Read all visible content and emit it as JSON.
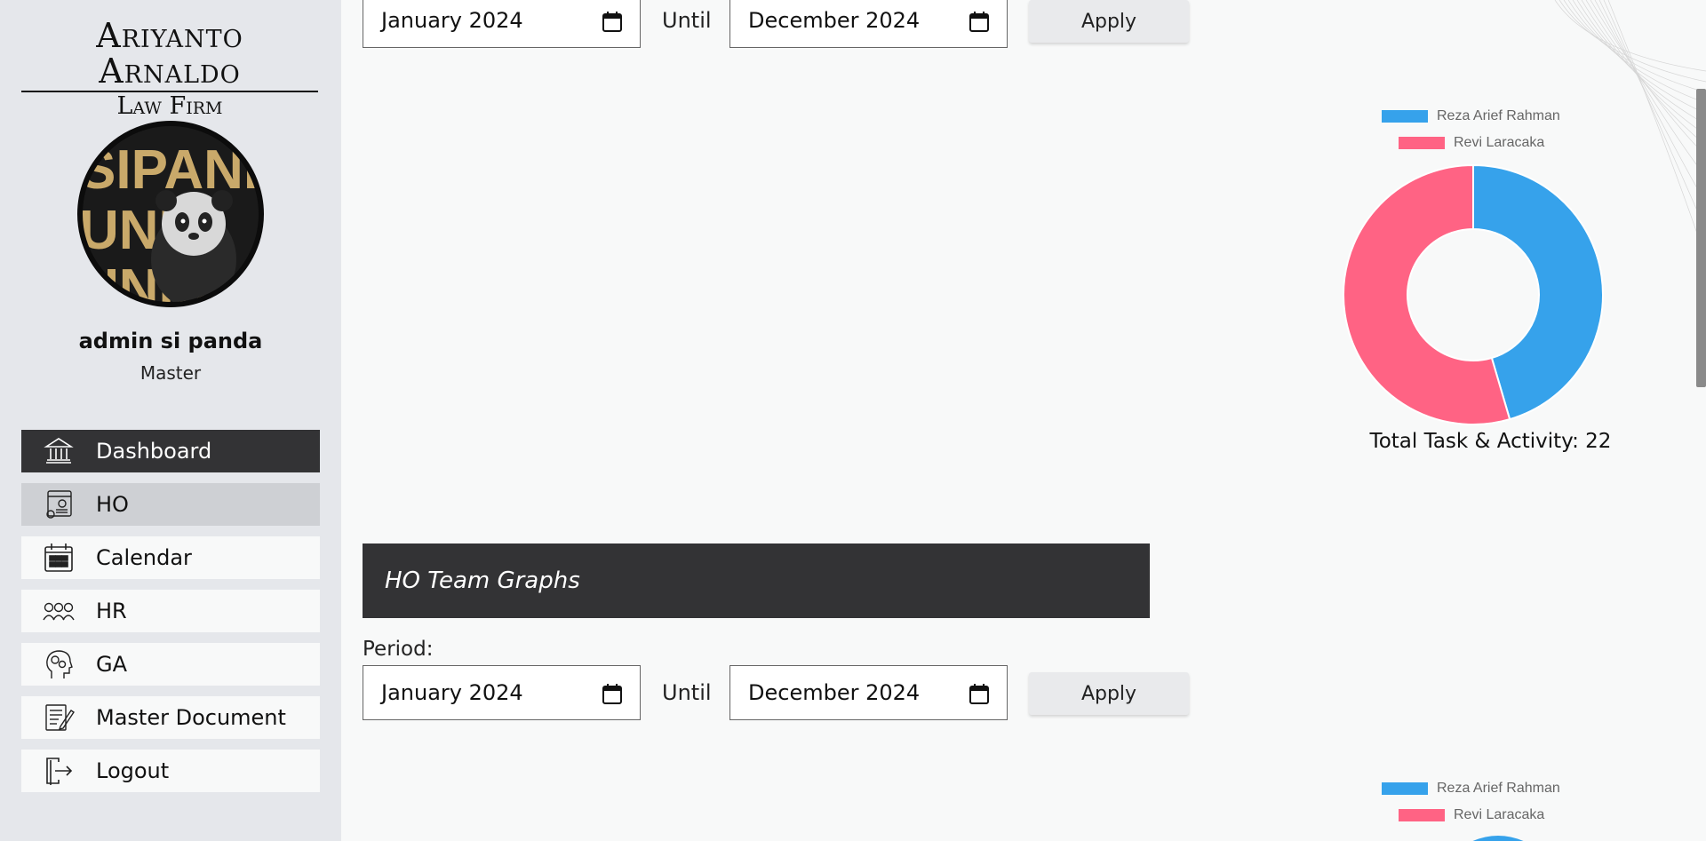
{
  "brand": {
    "line1": "Ariyanto Arnaldo",
    "line2": "Law Firm"
  },
  "user": {
    "name": "admin si panda",
    "role": "Master",
    "avatar_text": "SIPANDA UNIK"
  },
  "nav": [
    {
      "label": "Dashboard",
      "icon": "bank-icon"
    },
    {
      "label": "HO",
      "icon": "web-settings-icon"
    },
    {
      "label": "Calendar",
      "icon": "calendar-icon"
    },
    {
      "label": "HR",
      "icon": "team-icon"
    },
    {
      "label": "GA",
      "icon": "head-gears-icon"
    },
    {
      "label": "Master Document",
      "icon": "document-edit-icon"
    },
    {
      "label": "Logout",
      "icon": "logout-icon"
    }
  ],
  "filters_top": {
    "from": "January 2024",
    "until_label": "Until",
    "to": "December 2024",
    "apply": "Apply"
  },
  "chart1": {
    "legend": [
      "Reza Arief Rahman",
      "Revi Laracaka"
    ],
    "total_label": "Total Task & Activity: 22"
  },
  "section2": {
    "title": "HO Team Graphs",
    "period_label": "Period:",
    "from": "January 2024",
    "until_label": "Until",
    "to": "December 2024",
    "apply": "Apply",
    "legend": [
      "Reza Arief Rahman",
      "Revi Laracaka"
    ]
  },
  "colors": {
    "series1": "#36a2eb",
    "series2": "#ff6384",
    "dark": "#333335"
  },
  "chart_data": {
    "type": "pie",
    "categories": [
      "Reza Arief Rahman",
      "Revi Laracaka"
    ],
    "values": [
      10,
      12
    ],
    "legend": "top"
  }
}
